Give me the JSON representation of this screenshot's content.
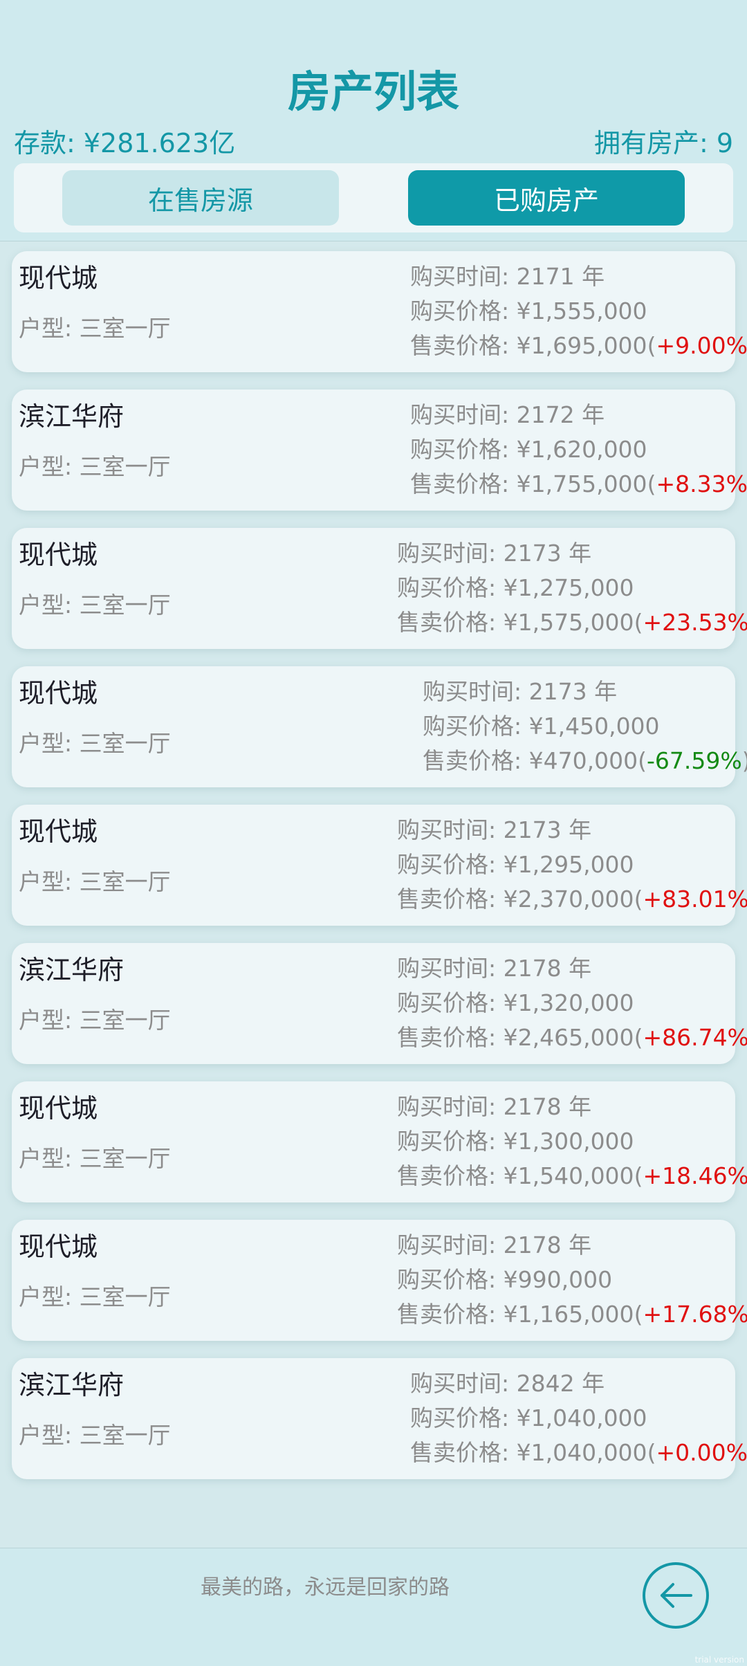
{
  "header": {
    "title": "房产列表",
    "savings": "存款: ¥281.623亿",
    "owned": "拥有房产: 9"
  },
  "tabs": [
    {
      "label": "在售房源",
      "active": false
    },
    {
      "label": "已购房产",
      "active": true
    }
  ],
  "properties": [
    {
      "name": "现代城",
      "type": "户型: 三室一厅",
      "buy_time": "购买时间: 2171 年",
      "buy_price": "购买价格: ¥1,555,000",
      "sell_price": "售卖价格: ¥1,695,000",
      "open": "(",
      "change": "+9.00%",
      "close": ")",
      "trend": "up"
    },
    {
      "name": "滨江华府",
      "type": "户型: 三室一厅",
      "buy_time": "购买时间: 2172 年",
      "buy_price": "购买价格: ¥1,620,000",
      "sell_price": "售卖价格: ¥1,755,000",
      "open": "(",
      "change": "+8.33%",
      "close": ")",
      "trend": "up"
    },
    {
      "name": "现代城",
      "type": "户型: 三室一厅",
      "buy_time": "购买时间: 2173 年",
      "buy_price": "购买价格: ¥1,275,000",
      "sell_price": "售卖价格: ¥1,575,000",
      "open": "(",
      "change": "+23.53%",
      "close": ")",
      "trend": "up"
    },
    {
      "name": "现代城",
      "type": "户型: 三室一厅",
      "buy_time": "购买时间: 2173 年",
      "buy_price": "购买价格: ¥1,450,000",
      "sell_price": "售卖价格: ¥470,000",
      "open": "(",
      "change": "-67.59%",
      "close": ")",
      "trend": "down"
    },
    {
      "name": "现代城",
      "type": "户型: 三室一厅",
      "buy_time": "购买时间: 2173 年",
      "buy_price": "购买价格: ¥1,295,000",
      "sell_price": "售卖价格: ¥2,370,000",
      "open": "(",
      "change": "+83.01%",
      "close": ")",
      "trend": "up"
    },
    {
      "name": "滨江华府",
      "type": "户型: 三室一厅",
      "buy_time": "购买时间: 2178 年",
      "buy_price": "购买价格: ¥1,320,000",
      "sell_price": "售卖价格: ¥2,465,000",
      "open": "(",
      "change": "+86.74%",
      "close": ")",
      "trend": "up"
    },
    {
      "name": "现代城",
      "type": "户型: 三室一厅",
      "buy_time": "购买时间: 2178 年",
      "buy_price": "购买价格: ¥1,300,000",
      "sell_price": "售卖价格: ¥1,540,000",
      "open": "(",
      "change": "+18.46%",
      "close": ")",
      "trend": "up"
    },
    {
      "name": "现代城",
      "type": "户型: 三室一厅",
      "buy_time": "购买时间: 2178 年",
      "buy_price": "购买价格: ¥990,000",
      "sell_price": "售卖价格: ¥1,165,000",
      "open": "(",
      "change": "+17.68%",
      "close": ")",
      "trend": "up"
    },
    {
      "name": "滨江华府",
      "type": "户型: 三室一厅",
      "buy_time": "购买时间: 2842 年",
      "buy_price": "购买价格: ¥1,040,000",
      "sell_price": "售卖价格: ¥1,040,000",
      "open": "(",
      "change": "+0.00%",
      "close": ")",
      "trend": "up"
    }
  ],
  "footer": {
    "motto": "最美的路，永远是回家的路",
    "back_icon": "arrow-left-circle-icon",
    "watermark": "trial version"
  },
  "colors": {
    "accent": "#1497a6",
    "background": "#cfeaee",
    "card": "#eef6f8",
    "gain": "#e01010",
    "loss": "#148a14"
  }
}
